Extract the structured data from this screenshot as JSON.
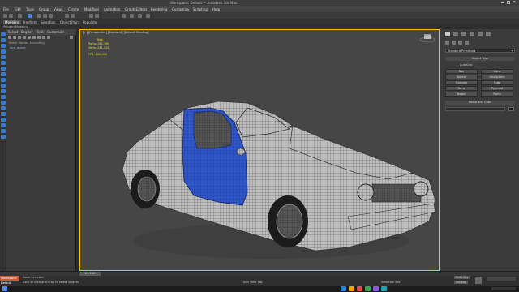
{
  "app": {
    "title": "Workspace: Default — Autodesk 3ds Max"
  },
  "menu": [
    "File",
    "Edit",
    "Tools",
    "Group",
    "Views",
    "Create",
    "Modifiers",
    "Animation",
    "Graph Editors",
    "Rendering",
    "Customize",
    "Scripting",
    "Help"
  ],
  "ribbon": {
    "tabs": [
      {
        "label": "Modeling",
        "active": true
      },
      {
        "label": "Freeform",
        "active": false
      },
      {
        "label": "Selection",
        "active": false
      },
      {
        "label": "Object Paint",
        "active": false
      },
      {
        "label": "Populate",
        "active": false
      }
    ],
    "sub_label": "Polygon Modeling"
  },
  "explorer": {
    "tabs": [
      "Select",
      "Display",
      "Edit",
      "Customize"
    ],
    "column_header": "Name (Sorted Ascending)",
    "rows": [
      "ford_escort"
    ]
  },
  "viewport": {
    "label": "[+] [Perspective] [Standard] [Default Shading]",
    "stats": {
      "total_label": "Total",
      "polys_label": "Polys:",
      "polys_value": "282,360",
      "verts_label": "Verts:",
      "verts_value": "281,520",
      "fps_label": "FPS:",
      "fps_value": "100,000"
    },
    "accent_selected_panel": "#3056c8"
  },
  "command_panel": {
    "dropdown_value": "Standard Primitives",
    "rollout_object_type": "Object Type",
    "autogrid": "AutoGrid",
    "object_types": [
      "Box",
      "Cone",
      "Sphere",
      "GeoSphere",
      "Cylinder",
      "Tube",
      "Torus",
      "Pyramid",
      "Teapot",
      "Plane"
    ],
    "rollout_name_color": "Name and Color"
  },
  "timeline": {
    "frame_label": "0 / 100"
  },
  "status": {
    "maxscript": "Workspace: Default",
    "selection": "None Selected",
    "prompt": "Click or click-and-drag to select objects",
    "add_time_tag": "Add Time Tag",
    "selection_set": "Selection Set:",
    "auto_key": "Auto Key",
    "set_key": "Set Key"
  },
  "taskbar": {
    "colors": [
      "#2d7dd2",
      "#f0a30a",
      "#e04c4c",
      "#3aa655",
      "#8a5cd6",
      "#1fa3a3"
    ]
  },
  "icons": [
    "undo-icon",
    "redo-icon",
    "link-icon",
    "select-icon",
    "move-icon",
    "rotate-icon",
    "scale-icon",
    "snap-icon",
    "render-icon",
    "teapot-icon"
  ]
}
